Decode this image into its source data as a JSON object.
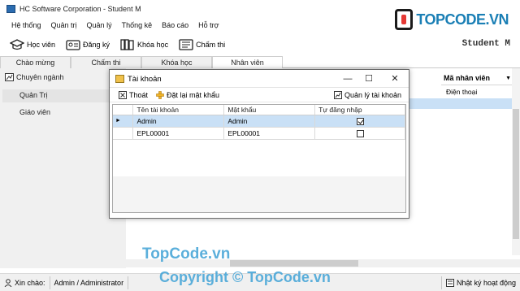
{
  "window": {
    "title": "HC Software Corporation - Student M"
  },
  "brand": {
    "logo_text": "TOPCODE.VN",
    "accent": "#1a7fb5"
  },
  "menu": [
    "Hệ thống",
    "Quản trị",
    "Quản lý",
    "Thống kê",
    "Báo cáo",
    "Hỗ trợ"
  ],
  "toolbar": {
    "items": [
      {
        "label": "Học viên",
        "icon": "graduation-cap-icon"
      },
      {
        "label": "Đăng ký",
        "icon": "id-card-icon"
      },
      {
        "label": "Khóa học",
        "icon": "books-icon"
      },
      {
        "label": "Chấm thi",
        "icon": "grading-list-icon"
      }
    ],
    "right_label": "Student M"
  },
  "tabs": [
    "Chào mừng",
    "Chấm thi",
    "Khóa học",
    "Nhân viên"
  ],
  "active_tab": "Nhân viên",
  "left_panel": {
    "header": "Chuyên ngành",
    "items": [
      "Quản Trị",
      "Giáo viên"
    ]
  },
  "main_grid": {
    "column": "Mã nhân viên",
    "row_value": "Điện thoại"
  },
  "dialog": {
    "title": "Tài khoản",
    "toolbar": {
      "exit": "Thoát",
      "reset": "Đặt lại mật khẩu",
      "manage": "Quản lý tài khoản"
    },
    "columns": [
      "Tên tài khoản",
      "Mật khẩu",
      "Tự đăng nhập"
    ],
    "rows": [
      {
        "username": "Admin",
        "password": "Admin",
        "auto_login": true
      },
      {
        "username": "EPL00001",
        "password": "EPL00001",
        "auto_login": false
      }
    ]
  },
  "status": {
    "greeting": "Xin chào:",
    "user": "Admin / Administrator",
    "log": "Nhật ký hoạt động"
  },
  "watermark": {
    "line1": "TopCode.vn",
    "line2": "Copyright © TopCode.vn"
  }
}
